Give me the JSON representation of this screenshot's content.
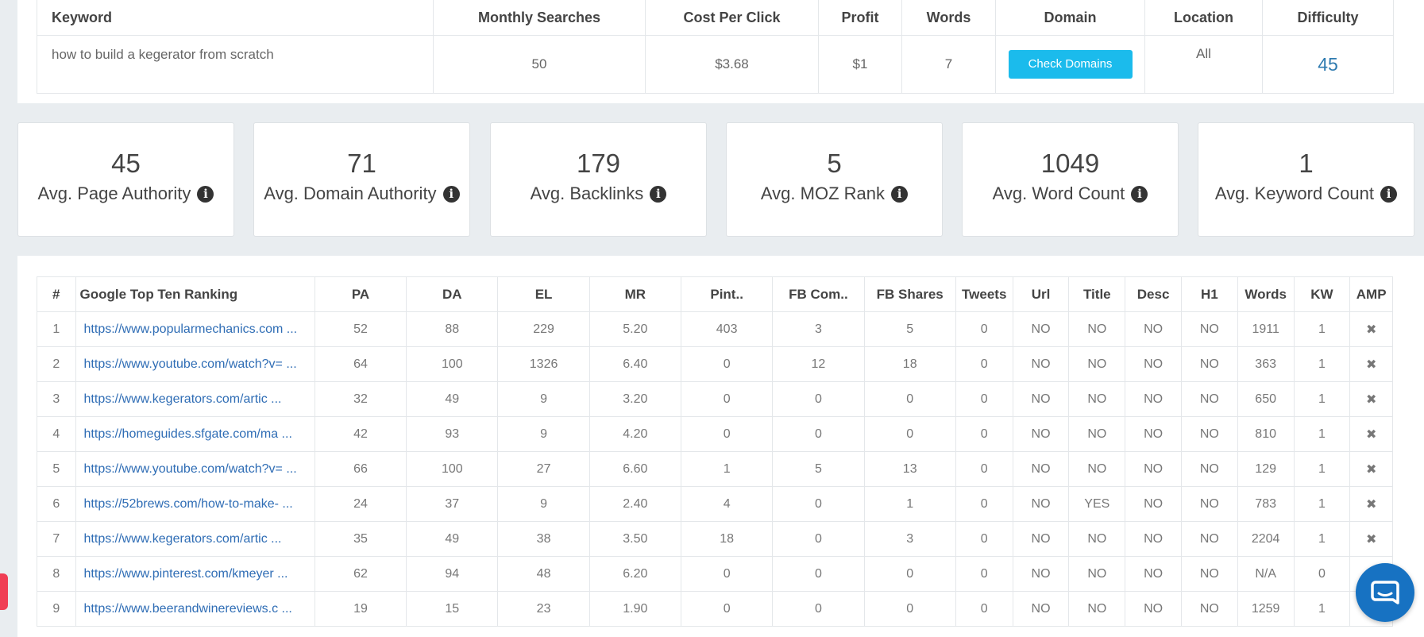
{
  "keyword_table": {
    "headers": [
      "Keyword",
      "Monthly Searches",
      "Cost Per Click",
      "Profit",
      "Words",
      "Domain",
      "Location",
      "Difficulty"
    ],
    "row": {
      "keyword": "how to build a kegerator from scratch",
      "monthly_searches": "50",
      "cost_per_click": "$3.68",
      "profit": "$1",
      "words": "7",
      "domain_button": "Check Domains",
      "location": "All",
      "difficulty": "45"
    }
  },
  "stats": [
    {
      "value": "45",
      "label": "Avg. Page Authority"
    },
    {
      "value": "71",
      "label": "Avg. Domain Authority"
    },
    {
      "value": "179",
      "label": "Avg. Backlinks"
    },
    {
      "value": "5",
      "label": "Avg. MOZ Rank"
    },
    {
      "value": "1049",
      "label": "Avg. Word Count"
    },
    {
      "value": "1",
      "label": "Avg. Keyword Count"
    }
  ],
  "info_icon_glyph": "i",
  "ranking_table": {
    "headers": [
      "#",
      "Google Top Ten Ranking",
      "PA",
      "DA",
      "EL",
      "MR",
      "Pint..",
      "FB Com..",
      "FB Shares",
      "Tweets",
      "Url",
      "Title",
      "Desc",
      "H1",
      "Words",
      "KW",
      "AMP"
    ],
    "rows": [
      [
        "1",
        "https://www.popularmechanics.com ...",
        "52",
        "88",
        "229",
        "5.20",
        "403",
        "3",
        "5",
        "0",
        "NO",
        "NO",
        "NO",
        "NO",
        "1911",
        "1",
        "✖"
      ],
      [
        "2",
        "https://www.youtube.com/watch?v= ...",
        "64",
        "100",
        "1326",
        "6.40",
        "0",
        "12",
        "18",
        "0",
        "NO",
        "NO",
        "NO",
        "NO",
        "363",
        "1",
        "✖"
      ],
      [
        "3",
        "https://www.kegerators.com/artic ...",
        "32",
        "49",
        "9",
        "3.20",
        "0",
        "0",
        "0",
        "0",
        "NO",
        "NO",
        "NO",
        "NO",
        "650",
        "1",
        "✖"
      ],
      [
        "4",
        "https://homeguides.sfgate.com/ma ...",
        "42",
        "93",
        "9",
        "4.20",
        "0",
        "0",
        "0",
        "0",
        "NO",
        "NO",
        "NO",
        "NO",
        "810",
        "1",
        "✖"
      ],
      [
        "5",
        "https://www.youtube.com/watch?v= ...",
        "66",
        "100",
        "27",
        "6.60",
        "1",
        "5",
        "13",
        "0",
        "NO",
        "NO",
        "NO",
        "NO",
        "129",
        "1",
        "✖"
      ],
      [
        "6",
        "https://52brews.com/how-to-make- ...",
        "24",
        "37",
        "9",
        "2.40",
        "4",
        "0",
        "1",
        "0",
        "NO",
        "YES",
        "NO",
        "NO",
        "783",
        "1",
        "✖"
      ],
      [
        "7",
        "https://www.kegerators.com/artic ...",
        "35",
        "49",
        "38",
        "3.50",
        "18",
        "0",
        "3",
        "0",
        "NO",
        "NO",
        "NO",
        "NO",
        "2204",
        "1",
        "✖"
      ],
      [
        "8",
        "https://www.pinterest.com/kmeyer ...",
        "62",
        "94",
        "48",
        "6.20",
        "0",
        "0",
        "0",
        "0",
        "NO",
        "NO",
        "NO",
        "NO",
        "N/A",
        "0",
        "✖"
      ],
      [
        "9",
        "https://www.beerandwinereviews.c ...",
        "19",
        "15",
        "23",
        "1.90",
        "0",
        "0",
        "0",
        "0",
        "NO",
        "NO",
        "NO",
        "NO",
        "1259",
        "1",
        "✖"
      ]
    ]
  },
  "colors": {
    "accent_button": "#1bbbec",
    "link": "#2f6db5",
    "difficulty": "#2f7bb0",
    "chat_bubble": "#1772c2",
    "side_tab": "#f03e54"
  },
  "icons": {
    "amp_icon": "close-icon",
    "chat_icon": "chat-icon"
  }
}
